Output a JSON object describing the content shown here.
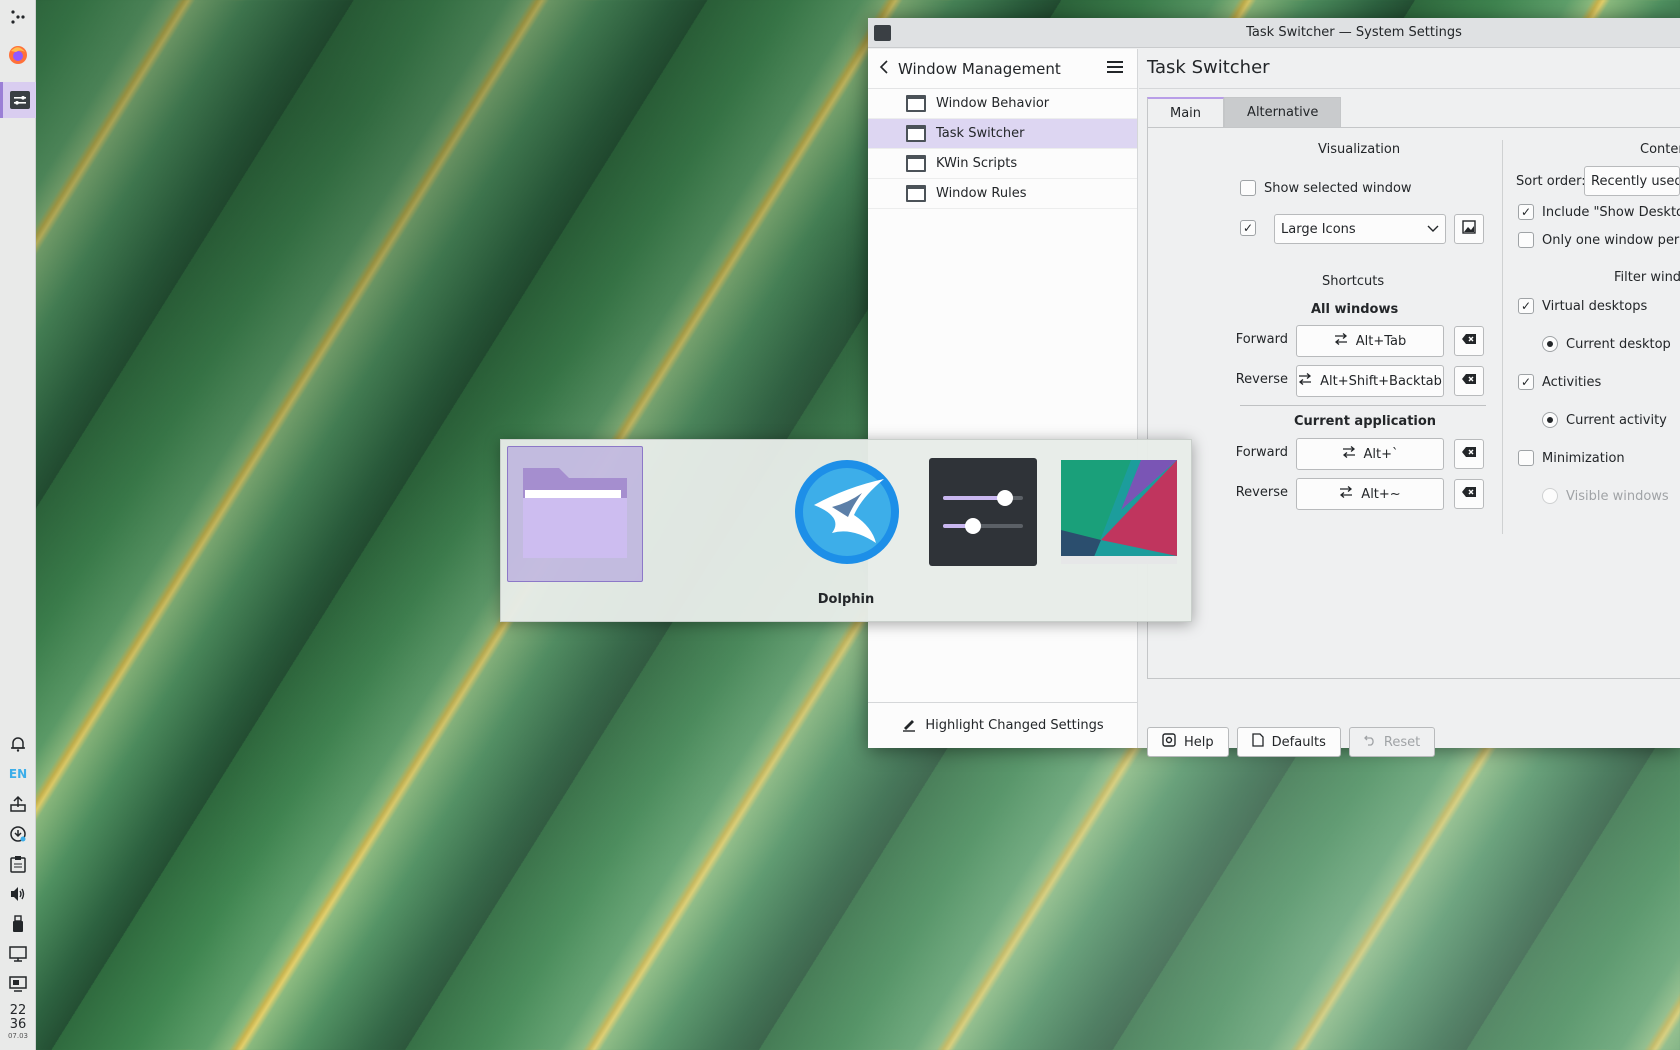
{
  "panel": {
    "items": [
      "launcher-icon",
      "firefox-icon",
      "system-settings-icon"
    ],
    "tray": [
      "notification-bell-icon",
      "language-indicator",
      "upload-icon",
      "update-icon",
      "clipboard-icon",
      "volume-icon",
      "usb-icon",
      "display-icon",
      "display-config-icon"
    ],
    "language": "EN",
    "clock": {
      "hour": "22",
      "minute": "36",
      "date": "07.03"
    }
  },
  "window": {
    "title": "Task Switcher — System Settings",
    "sidebar": {
      "title": "Window Management",
      "items": [
        {
          "label": "Window Behavior"
        },
        {
          "label": "Task Switcher"
        },
        {
          "label": "KWin Scripts"
        },
        {
          "label": "Window Rules"
        }
      ],
      "footer_label": "Highlight Changed Settings"
    },
    "page_title": "Task Switcher",
    "tabs": [
      {
        "label": "Main"
      },
      {
        "label": "Alternative"
      }
    ],
    "visualization": {
      "title": "Visualization",
      "show_selected_window": "Show selected window",
      "layout_value": "Large Icons"
    },
    "shortcuts": {
      "title": "Shortcuts",
      "all_windows": "All windows",
      "current_application": "Current application",
      "forward_label": "Forward",
      "reverse_label": "Reverse",
      "all_forward": "Alt+Tab",
      "all_reverse": "Alt+Shift+Backtab",
      "app_forward": "Alt+`",
      "app_reverse": "Alt+~"
    },
    "content": {
      "title": "Conter",
      "sort_order_label": "Sort order:",
      "sort_order_value": "Recently used",
      "include_show_desktop": "Include \"Show Desktop",
      "only_one_window": "Only one window per a",
      "filter_title": "Filter windo",
      "virtual_desktops": "Virtual desktops",
      "current_desktop": "Current desktop",
      "activities": "Activities",
      "current_activity": "Current activity",
      "minimization": "Minimization",
      "visible_windows": "Visible windows"
    },
    "buttons": {
      "help": "Help",
      "defaults": "Defaults",
      "reset": "Reset"
    }
  },
  "switcher": {
    "selected_label": "Dolphin",
    "apps": [
      "folder-icon",
      "krunner-icon",
      "settings-sliders-icon",
      "desktop-thumbnail-icon"
    ]
  }
}
